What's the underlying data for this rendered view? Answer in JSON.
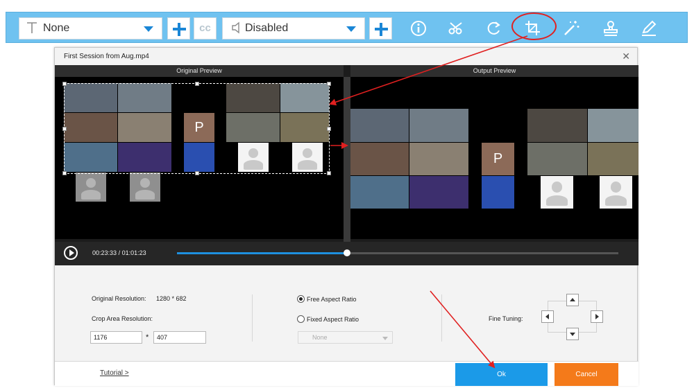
{
  "colors": {
    "toolbar_bg": "#6fc2f0",
    "accent_blue": "#1a86d6",
    "ok_button": "#1b9ae8",
    "cancel_button": "#f47a1a",
    "annotation_red": "#e02020"
  },
  "toolbar": {
    "subtitle_select": {
      "value": "None",
      "icon": "text-t-icon"
    },
    "add_subtitle_icon": "plus-icon",
    "cc_label": "cc",
    "audio_select": {
      "value": "Disabled",
      "icon": "speaker-icon"
    },
    "add_audio_icon": "plus-icon",
    "tools": [
      "info-icon",
      "scissors-icon",
      "rotate-icon",
      "crop-icon",
      "magic-wand-icon",
      "watermark-stamp-icon",
      "edit-pen-icon"
    ]
  },
  "dialog": {
    "title": "First Session from Aug.mp4",
    "close_icon": "close-icon",
    "original_preview_label": "Original Preview",
    "output_preview_label": "Output Preview",
    "participant_initial": "P",
    "playback": {
      "current_time": "00:23:33",
      "separator": "/",
      "total_time": "01:01:23",
      "progress": 0.385
    },
    "settings": {
      "original_resolution_label": "Original Resolution:",
      "original_resolution_value": "1280 * 682",
      "crop_area_label": "Crop Area Resolution:",
      "crop_width": "1176",
      "crop_multiply": "*",
      "crop_height": "407",
      "free_aspect_label": "Free Aspect Ratio",
      "fixed_aspect_label": "Fixed Aspect Ratio",
      "aspect_selected": "free",
      "ratio_select_value": "None",
      "fine_tuning_label": "Fine Tuning:"
    },
    "footer": {
      "tutorial_link": "Tutorial >",
      "ok_label": "Ok",
      "cancel_label": "Cancel"
    }
  }
}
